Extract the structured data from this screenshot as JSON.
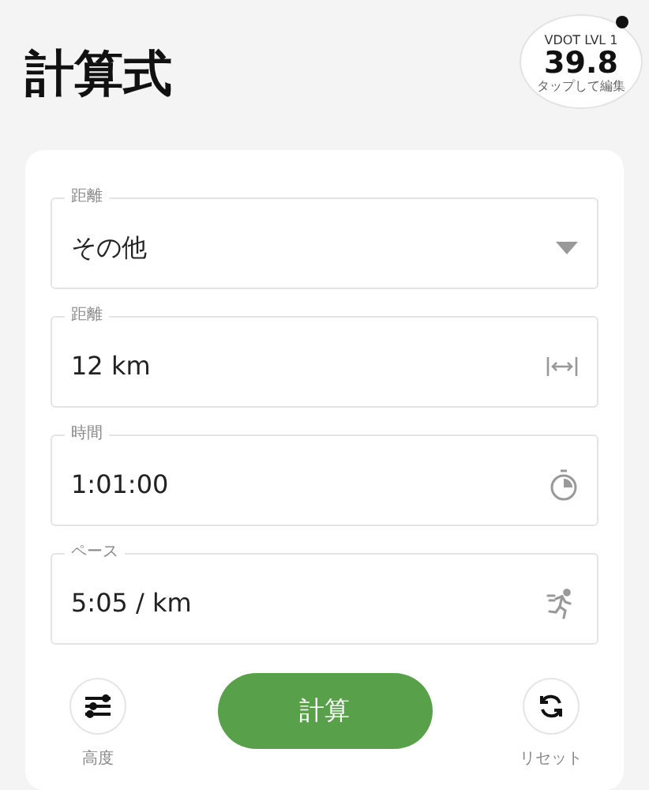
{
  "title": "計算式",
  "vdot": {
    "label": "VDOT LVL 1",
    "value": "39.8",
    "hint": "タップして編集"
  },
  "fields": [
    {
      "kind": "select",
      "label": "距離",
      "value": "その他"
    },
    {
      "kind": "distance",
      "label": "距離",
      "value": "12 km"
    },
    {
      "kind": "time",
      "label": "時間",
      "value": "1:01:00"
    },
    {
      "kind": "pace",
      "label": "ペース",
      "value": "5:05 / km"
    }
  ],
  "actions": {
    "left": {
      "label": "高度"
    },
    "primary": {
      "label": "計算"
    },
    "right": {
      "label": "リセット"
    }
  }
}
